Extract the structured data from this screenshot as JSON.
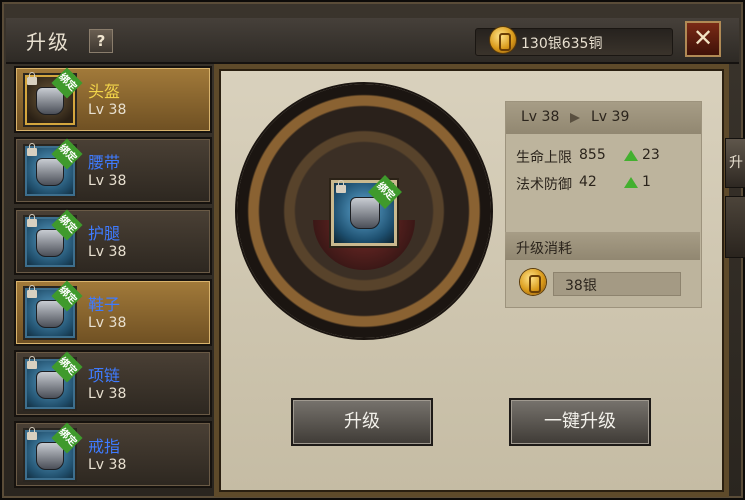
{
  "window": {
    "title": "升级",
    "help_label": "?",
    "currency": "130银635铜",
    "close_label": "✕"
  },
  "equipment_list": [
    {
      "name": "头盔",
      "level": "Lv 38",
      "badge": "绑定"
    },
    {
      "name": "腰带",
      "level": "Lv 38",
      "badge": "绑定"
    },
    {
      "name": "护腿",
      "level": "Lv 38",
      "badge": "绑定"
    },
    {
      "name": "鞋子",
      "level": "Lv 38",
      "badge": "绑定"
    },
    {
      "name": "项链",
      "level": "Lv 38",
      "badge": "绑定"
    },
    {
      "name": "戒指",
      "level": "Lv 38",
      "badge": "绑定"
    }
  ],
  "selected_item": {
    "badge": "绑定"
  },
  "upgrade_info": {
    "from": "Lv 38",
    "to": "Lv 39",
    "stats": [
      {
        "label": "生命上限",
        "value": "855",
        "gain": "23"
      },
      {
        "label": "法术防御",
        "value": "42",
        "gain": "1"
      }
    ],
    "cost_title": "升级消耗",
    "cost": "38银"
  },
  "actions": {
    "upgrade": "升级",
    "one_click": "一键升级"
  },
  "side": {
    "tab_label": "升"
  },
  "colors": {
    "selected_name": "#f2d44a",
    "item_name": "#3f7bff",
    "gain_arrow": "#43b02f"
  },
  "icons": {
    "coin": "coin-icon",
    "lock": "lock-icon",
    "close": "close-icon",
    "up_arrow": "up-arrow-icon",
    "right_arrow": "right-arrow-icon"
  }
}
